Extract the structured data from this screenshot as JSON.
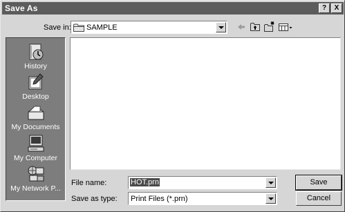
{
  "window": {
    "title": "Save As",
    "help_button": "?",
    "close_button": "X"
  },
  "save_in": {
    "label": "Save in:",
    "value": "SAMPLE",
    "icon": "folder-icon"
  },
  "toolbar": {
    "icons": [
      "back-arrow-icon",
      "up-folder-icon",
      "new-folder-icon",
      "view-menu-icon"
    ]
  },
  "places": [
    {
      "label": "History",
      "icon": "history-icon"
    },
    {
      "label": "Desktop",
      "icon": "desktop-icon"
    },
    {
      "label": "My Documents",
      "icon": "my-documents-icon"
    },
    {
      "label": "My Computer",
      "icon": "my-computer-icon"
    },
    {
      "label": "My Network P...",
      "icon": "my-network-places-icon"
    }
  ],
  "file_name": {
    "label": "File name:",
    "value": "HOT.prn"
  },
  "save_as_type": {
    "label": "Save as type:",
    "value": "Print Files (*.prn)"
  },
  "buttons": {
    "save": "Save",
    "cancel": "Cancel"
  }
}
